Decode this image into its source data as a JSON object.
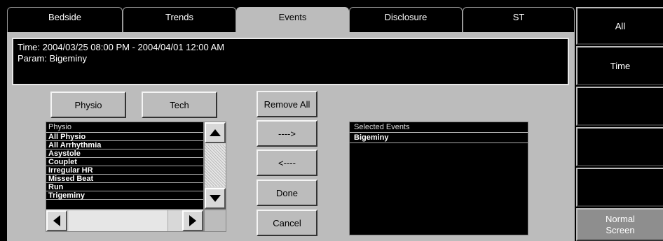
{
  "tabs": [
    {
      "label": "Bedside"
    },
    {
      "label": "Trends"
    },
    {
      "label": "Events"
    },
    {
      "label": "Disclosure"
    },
    {
      "label": "ST"
    }
  ],
  "info": {
    "time_line": "Time: 2004/03/25  08:00 PM  -  2004/04/01  12:00 AM",
    "param_line": "Param: Bigeminy"
  },
  "buttons": {
    "physio": "Physio",
    "tech": "Tech",
    "remove_all": "Remove All",
    "add": "---->",
    "remove": "<----",
    "done": "Done",
    "cancel": "Cancel"
  },
  "physio_list": {
    "header": "Physio",
    "items": [
      "All Physio",
      "All Arrhythmia",
      "Asystole",
      "Couplet",
      "Irregular HR",
      "Missed Beat",
      "Run",
      "Trigeminy"
    ]
  },
  "selected_list": {
    "header": "Selected Events",
    "items": [
      "Bigeminy"
    ]
  },
  "side_buttons": {
    "all": "All",
    "time": "Time",
    "blank1": "",
    "blank2": "",
    "blank3": "",
    "normal_screen": "Normal\nScreen"
  }
}
